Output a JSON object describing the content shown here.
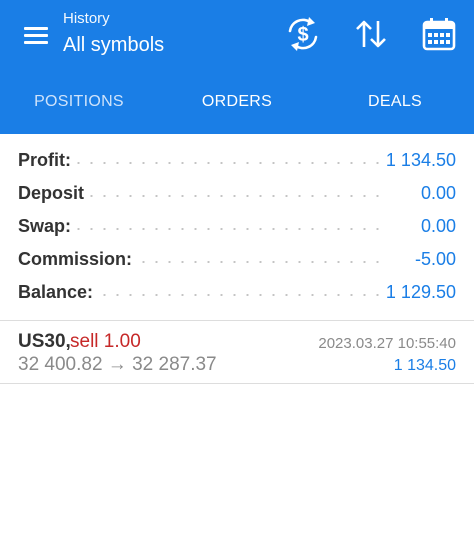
{
  "header": {
    "subtitle": "History",
    "title": "All symbols",
    "icons": [
      "menu-icon",
      "currency-exchange-icon",
      "sort-arrows-icon",
      "calendar-icon"
    ]
  },
  "tabs": [
    {
      "label": "POSITIONS",
      "active": true
    },
    {
      "label": "ORDERS",
      "active": false
    },
    {
      "label": "DEALS",
      "active": false
    }
  ],
  "summary": [
    {
      "label": "Profit:",
      "value": "1 134.50"
    },
    {
      "label": "Deposit",
      "value": "0.00"
    },
    {
      "label": "Swap:",
      "value": "0.00"
    },
    {
      "label": "Commission:",
      "value": "-5.00"
    },
    {
      "label": "Balance:",
      "value": "1 129.50"
    }
  ],
  "deal": {
    "symbol": "US30,",
    "side": "sell 1.00",
    "prices": "32 400.82 → 32 287.37",
    "time": "2023.03.27 10:55:40",
    "profit": "1 134.50"
  },
  "colors": {
    "brand": "#1a7ee6",
    "sell": "#c62828",
    "muted": "#8a8a8a"
  }
}
